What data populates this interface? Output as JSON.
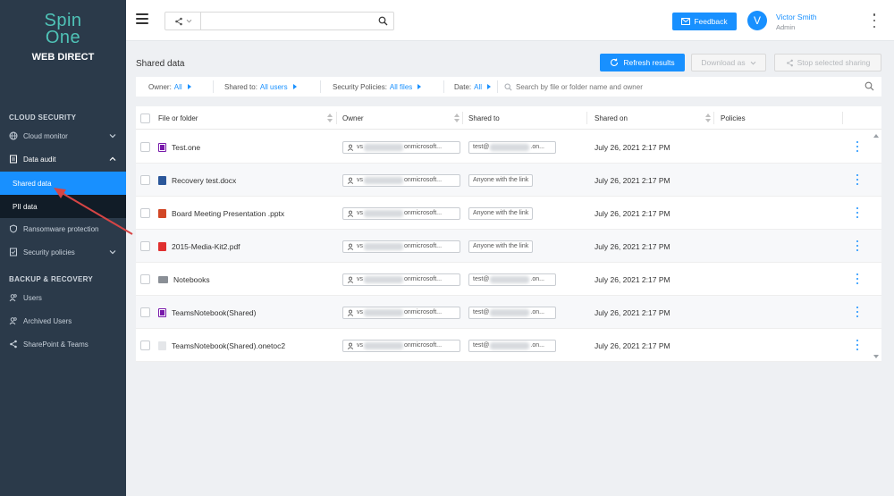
{
  "sidebar": {
    "logo_line1": "Spin",
    "logo_line2": "One",
    "logo_sub": "WEB DIRECT",
    "section_cloud": "CLOUD SECURITY",
    "cloud_monitor": "Cloud monitor",
    "data_audit": "Data audit",
    "shared_data": "Shared data",
    "pii_data": "PII data",
    "ransomware": "Ransomware protection",
    "security_policies": "Security policies",
    "section_backup": "BACKUP & RECOVERY",
    "users": "Users",
    "archived_users": "Archived Users",
    "sharepoint": "SharePoint & Teams"
  },
  "topbar": {
    "search_value": "",
    "feedback_label": "Feedback",
    "avatar_initial": "V",
    "user_name": "Victor Smith",
    "user_role": "Admin"
  },
  "page": {
    "title": "Shared data",
    "refresh_label": "Refresh results",
    "download_label": "Download as",
    "stop_label": "Stop selected sharing"
  },
  "filters": {
    "owner_label": "Owner:",
    "owner_value": "All",
    "shared_to_label": "Shared to:",
    "shared_to_value": "All users",
    "policies_label": "Security Policies:",
    "policies_value": "All files",
    "date_label": "Date:",
    "date_value": "All",
    "search_placeholder": "Search by file or folder name and owner"
  },
  "table": {
    "columns": {
      "file": "File or folder",
      "owner": "Owner",
      "shared_to": "Shared to",
      "shared_on": "Shared on",
      "policies": "Policies"
    },
    "rows": [
      {
        "name": "Test.one",
        "icon": "onenote-icon",
        "owner_prefix": "vs",
        "owner_suffix": "onmicrosoft...",
        "shared_prefix": "test@",
        "shared_suffix": ".on...",
        "shared_on": "July 26, 2021 2:17 PM"
      },
      {
        "name": "Recovery test.docx",
        "icon": "word-icon",
        "owner_prefix": "vs",
        "owner_suffix": "onmicrosoft...",
        "shared_text": "Anyone with the link",
        "shared_on": "July 26, 2021 2:17 PM"
      },
      {
        "name": "Board Meeting Presentation .pptx",
        "icon": "powerpoint-icon",
        "owner_prefix": "vs",
        "owner_suffix": "onmicrosoft...",
        "shared_text": "Anyone with the link",
        "shared_on": "July 26, 2021 2:17 PM"
      },
      {
        "name": "2015-Media-Kit2.pdf",
        "icon": "pdf-icon",
        "owner_prefix": "vs",
        "owner_suffix": "onmicrosoft...",
        "shared_text": "Anyone with the link",
        "shared_on": "July 26, 2021 2:17 PM"
      },
      {
        "name": "Notebooks",
        "icon": "folder-icon",
        "owner_prefix": "vs",
        "owner_suffix": "onmicrosoft...",
        "shared_prefix": "test@",
        "shared_suffix": ".on...",
        "shared_on": "July 26, 2021 2:17 PM"
      },
      {
        "name": "TeamsNotebook(Shared)",
        "icon": "onenote-notebook-icon",
        "owner_prefix": "vs",
        "owner_suffix": "onmicrosoft...",
        "shared_prefix": "test@",
        "shared_suffix": ".on...",
        "shared_on": "July 26, 2021 2:17 PM"
      },
      {
        "name": "TeamsNotebook(Shared).onetoc2",
        "icon": "generic-file-icon",
        "owner_prefix": "vs",
        "owner_suffix": "onmicrosoft...",
        "shared_prefix": "test@",
        "shared_suffix": ".on...",
        "shared_on": "July 26, 2021 2:17 PM"
      }
    ]
  },
  "colors": {
    "accent": "#1890ff",
    "sidebar_bg": "#2b3a4a",
    "logo": "#4fc3b7",
    "annotation_arrow": "#d64545"
  }
}
